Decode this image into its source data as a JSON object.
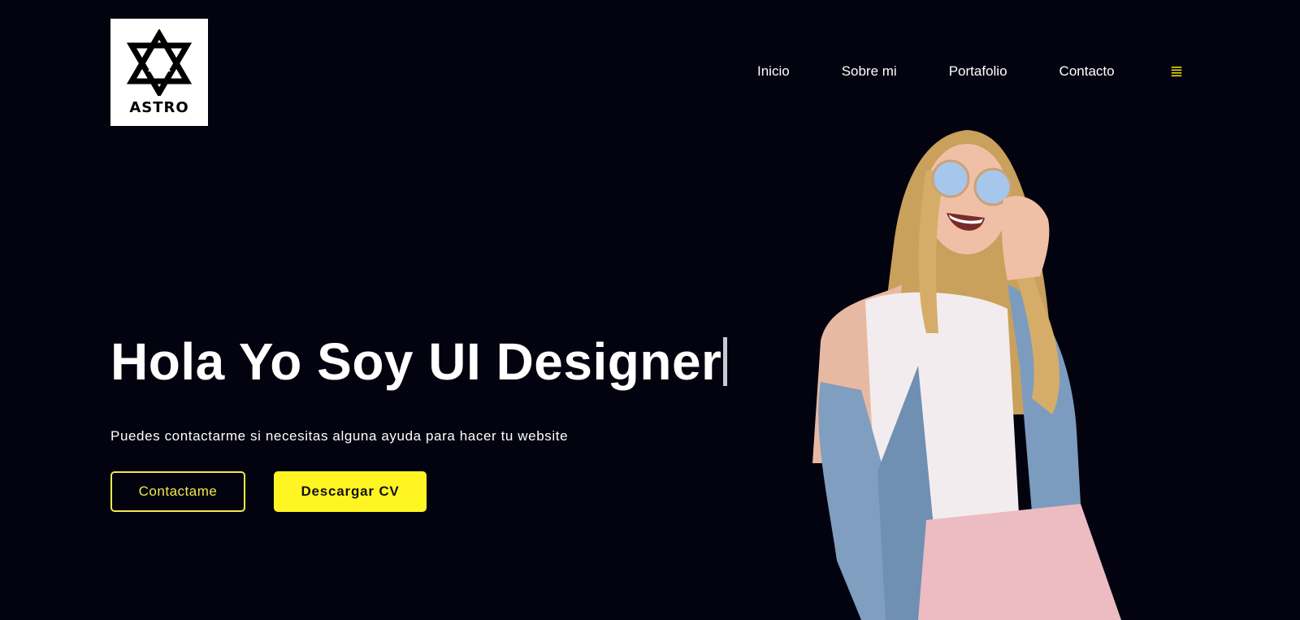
{
  "brand": {
    "logo_text": "ASTRO"
  },
  "nav": {
    "items": [
      {
        "label": "Inicio"
      },
      {
        "label": "Sobre mi"
      },
      {
        "label": "Portafolio"
      },
      {
        "label": "Contacto"
      }
    ],
    "menu_icon": "≣"
  },
  "hero": {
    "title": "Hola Yo Soy UI Designer",
    "subtitle": "Puedes contactarme si necesitas alguna ayuda para hacer tu website",
    "primary_button": "Contactame",
    "secondary_button": "Descargar CV"
  },
  "colors": {
    "background": "#03030f",
    "accent": "#fff523",
    "accent_outline": "#f2e94a",
    "text": "#ffffff"
  },
  "icons": {
    "logo": "star-of-david-logo-icon",
    "menu": "hamburger-menu-icon"
  }
}
